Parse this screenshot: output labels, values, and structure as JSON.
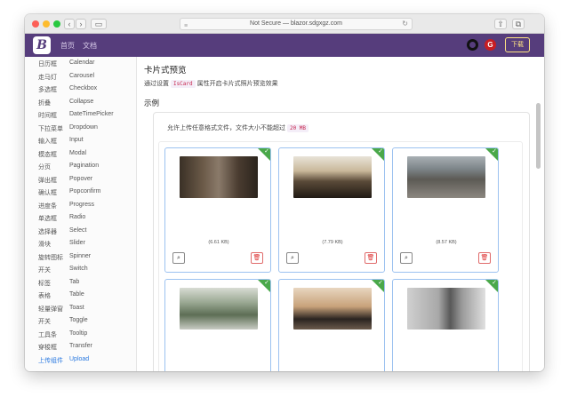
{
  "browser": {
    "url": "Not Secure — blazor.sdgxgz.com"
  },
  "navbar": {
    "logo": "B",
    "links": [
      "首页",
      "文档"
    ],
    "download_label": "下载",
    "gitee_label": "G"
  },
  "sidebar": {
    "items": [
      {
        "cn": "日历框",
        "en": "Calendar"
      },
      {
        "cn": "走马灯",
        "en": "Carousel"
      },
      {
        "cn": "多选框",
        "en": "Checkbox"
      },
      {
        "cn": "折叠",
        "en": "Collapse"
      },
      {
        "cn": "时间框",
        "en": "DateTimePicker"
      },
      {
        "cn": "下拉菜单",
        "en": "Dropdown"
      },
      {
        "cn": "输入框",
        "en": "Input"
      },
      {
        "cn": "模态框",
        "en": "Modal"
      },
      {
        "cn": "分页",
        "en": "Pagination"
      },
      {
        "cn": "弹出框",
        "en": "Popover"
      },
      {
        "cn": "确认框",
        "en": "Popconfirm"
      },
      {
        "cn": "进度条",
        "en": "Progress"
      },
      {
        "cn": "单选框",
        "en": "Radio"
      },
      {
        "cn": "选择器",
        "en": "Select"
      },
      {
        "cn": "滑块",
        "en": "Slider"
      },
      {
        "cn": "旋转图标",
        "en": "Spinner"
      },
      {
        "cn": "开关",
        "en": "Switch"
      },
      {
        "cn": "标签",
        "en": "Tab"
      },
      {
        "cn": "表格",
        "en": "Table"
      },
      {
        "cn": "轻量弹窗",
        "en": "Toast"
      },
      {
        "cn": "开关",
        "en": "Toggle"
      },
      {
        "cn": "工具条",
        "en": "Tooltip"
      },
      {
        "cn": "穿梭框",
        "en": "Transfer"
      },
      {
        "cn": "上传组件",
        "en": "Upload"
      }
    ],
    "active_index": 23
  },
  "main": {
    "section_title": "卡片式预览",
    "desc_before": "通过设置",
    "desc_code": "IsCard",
    "desc_after": "属性开启卡片式照片预览效果",
    "example_title": "示例",
    "hint_text": "允许上传任意格式文件，文件大小不能超过",
    "hint_code": "20 MB",
    "cards": [
      {
        "size": "(6.61 KB)",
        "image": "person-sitting-photo"
      },
      {
        "size": "(7.79 KB)",
        "image": "mountain-sunset-photo"
      },
      {
        "size": "(8.57 KB)",
        "image": "pier-bench-photo"
      },
      {
        "size": "",
        "image": "forest-balcony-photo"
      },
      {
        "size": "",
        "image": "sunset-rocks-beach-photo"
      },
      {
        "size": "",
        "image": "statue-of-liberty-photo"
      }
    ],
    "zoom_icon": "⌕",
    "delete_icon": "🗑"
  },
  "colors": {
    "navbar": "#563d7c",
    "accent": "#2b7ae0",
    "success_corner": "#4aa84a",
    "delete": "#dc3545"
  }
}
